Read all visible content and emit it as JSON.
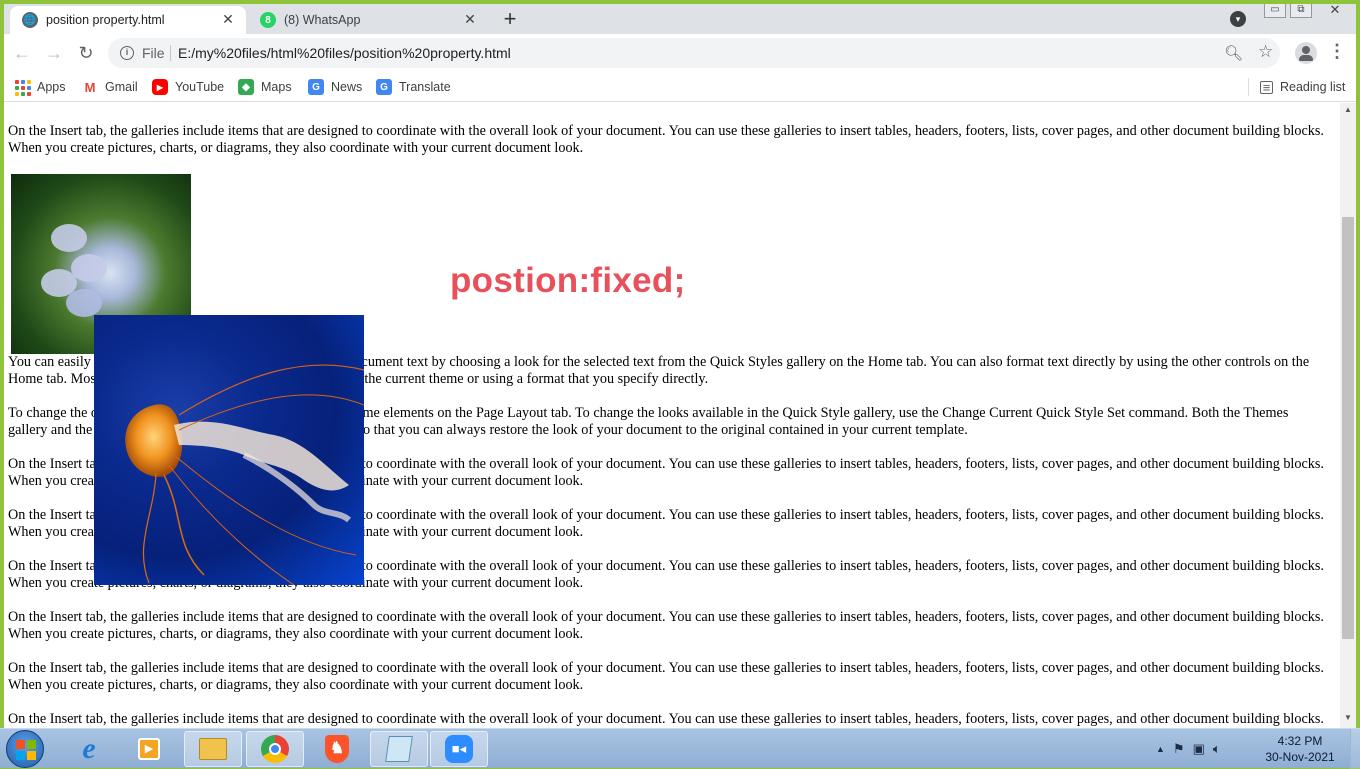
{
  "browser": {
    "tabs": [
      {
        "title": "position property.html",
        "active": true
      },
      {
        "title": "(8) WhatsApp",
        "active": false
      }
    ],
    "url_scheme": "File",
    "url": "E:/my%20files/html%20files/position%20property.html"
  },
  "bookmarks": [
    {
      "label": "Apps",
      "icon": "apps-grid-icon"
    },
    {
      "label": "Gmail",
      "icon": "gmail-icon"
    },
    {
      "label": "YouTube",
      "icon": "youtube-icon"
    },
    {
      "label": "Maps",
      "icon": "maps-icon"
    },
    {
      "label": "News",
      "icon": "news-icon"
    },
    {
      "label": "Translate",
      "icon": "translate-icon"
    }
  ],
  "reading_list": "Reading list",
  "page": {
    "heading": "postion:fixed;",
    "paragraphs": [
      "On the Insert tab, the galleries include items that are designed to coordinate with the overall look of your document. You can use these galleries to insert tables, headers, footers, lists, cover pages, and other document building blocks. When you create pictures, charts, or diagrams, they also coordinate with your current document look.",
      "You can easily change the formatting of selected text in the document text by choosing a look for the selected text from the Quick Styles gallery on the Home tab. You can also format text directly by using the other controls on the Home tab. Most controls offer a choice of using the look from the current theme or using a format that you specify directly.",
      "To change the overall look of your document, choose new Theme elements on the Page Layout tab. To change the looks available in the Quick Style gallery, use the Change Current Quick Style Set command. Both the Themes gallery and the Quick Styles gallery provide reset commands so that you can always restore the look of your document to the original contained in your current template.",
      "On the Insert tab, the galleries include items that are designed to coordinate with the overall look of your document. You can use these galleries to insert tables, headers, footers, lists, cover pages, and other document building blocks. When you create pictures, charts, or diagrams, they also coordinate with your current document look.",
      "On the Insert tab, the galleries include items that are designed to coordinate with the overall look of your document. You can use these galleries to insert tables, headers, footers, lists, cover pages, and other document building blocks. When you create pictures, charts, or diagrams, they also coordinate with your current document look.",
      "On the Insert tab, the galleries include items that are designed to coordinate with the overall look of your document. You can use these galleries to insert tables, headers, footers, lists, cover pages, and other document building blocks. When you create pictures, charts, or diagrams, they also coordinate with your current document look.",
      "On the Insert tab, the galleries include items that are designed to coordinate with the overall look of your document. You can use these galleries to insert tables, headers, footers, lists, cover pages, and other document building blocks. When you create pictures, charts, or diagrams, they also coordinate with your current document look.",
      "On the Insert tab, the galleries include items that are designed to coordinate with the overall look of your document. You can use these galleries to insert tables, headers, footers, lists, cover pages, and other document building blocks. When you create pictures, charts, or diagrams, they also coordinate with your current document look.",
      "On the Insert tab, the galleries include items that are designed to coordinate with the overall look of your document. You can use these galleries to insert tables, headers, footers, lists, cover pages, and other document building blocks. When you create pictures, charts, or diagrams, they also coordinate with your current document look."
    ],
    "heading_color": "#e8505b"
  },
  "taskbar": {
    "pinned": [
      "internet-explorer-icon",
      "media-player-icon",
      "file-explorer-icon",
      "chrome-icon",
      "brave-icon",
      "notepad-icon",
      "zoom-icon"
    ],
    "time": "4:32 PM",
    "date": "30-Nov-2021"
  },
  "colors": {
    "window_frame": "#8fc43a",
    "accent_blue": "#1a73e8"
  }
}
